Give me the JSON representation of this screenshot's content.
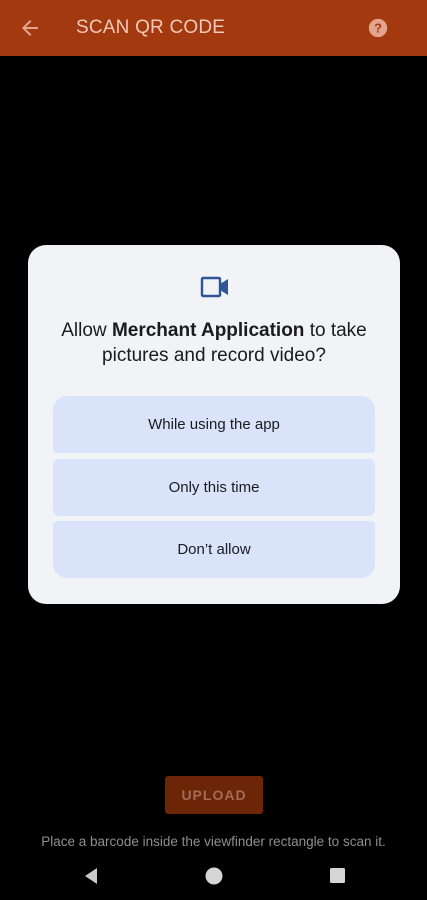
{
  "app_bar": {
    "title": "SCAN QR CODE",
    "background_color": "#a33a0f",
    "back_icon": "arrow-left-icon",
    "help_icon": "help-circle-icon"
  },
  "permission_dialog": {
    "icon": "videocam-icon",
    "message_prefix": "Allow ",
    "app_name": "Merchant Application",
    "message_suffix": " to take pictures and record video?",
    "options": [
      "While using the app",
      "Only this time",
      "Don’t allow"
    ],
    "option_color": "#d9e4fb"
  },
  "upload_button": {
    "label": "UPLOAD"
  },
  "hint": {
    "text": "Place a barcode inside the viewfinder rectangle to scan it."
  },
  "navigation_bar": {
    "back_icon": "nav-back-icon",
    "home_icon": "nav-home-icon",
    "recents_icon": "nav-recents-icon"
  }
}
